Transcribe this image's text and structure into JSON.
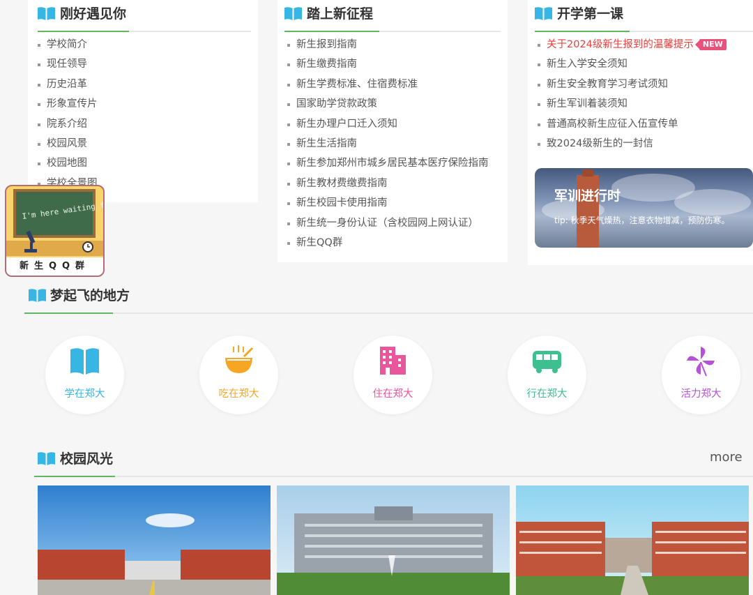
{
  "colors": {
    "accent_green": "#5fb65f",
    "book_blue": "#38b6e3",
    "hot_red": "#e8413c"
  },
  "col1": {
    "title": "刚好遇见你",
    "items": [
      "学校简介",
      "现任领导",
      "历史沿革",
      "形象宣传片",
      "院系介绍",
      "校园风景",
      "校园地图",
      "学校全景图"
    ]
  },
  "col2": {
    "title": "踏上新征程",
    "items": [
      "新生报到指南",
      "新生缴费指南",
      "新生学费标准、住宿费标准",
      "国家助学贷款政策",
      "新生办理户口迁入须知",
      "新生生活指南",
      "新生参加郑州市城乡居民基本医疗保险指南",
      "新生教材费缴费指南",
      "新生校园卡使用指南",
      "新生统一身份认证（含校园网上网认证）",
      "新生QQ群"
    ]
  },
  "col3": {
    "title": "开学第一课",
    "hot_item": "关于2024级新生报到的温馨提示",
    "badge": "NEW",
    "items": [
      "新生入学安全须知",
      "新生安全教育学习考试须知",
      "新生军训着装须知",
      "普通高校新生应征入伍宣传单",
      "致2024级新生的一封信"
    ],
    "banner_title": "军训进行时",
    "banner_tip": "tip: 秋季天气燥热，注意衣物增减，预防伤寒。"
  },
  "qq_card": {
    "board_text": "I'm here waiting for you",
    "label": "新生QQ群"
  },
  "dream": {
    "title": "梦起飞的地方",
    "items": [
      {
        "label": "学在郑大",
        "icon": "book-icon",
        "color": "#38b6e3"
      },
      {
        "label": "吃在郑大",
        "icon": "bowl-icon",
        "color": "#f6a623"
      },
      {
        "label": "住在郑大",
        "icon": "building-icon",
        "color": "#e9569b"
      },
      {
        "label": "行在郑大",
        "icon": "bus-icon",
        "color": "#3dbf8f"
      },
      {
        "label": "活力郑大",
        "icon": "pinwheel-icon",
        "color": "#b452d8"
      }
    ]
  },
  "scenery": {
    "title": "校园风光",
    "more": "more"
  }
}
